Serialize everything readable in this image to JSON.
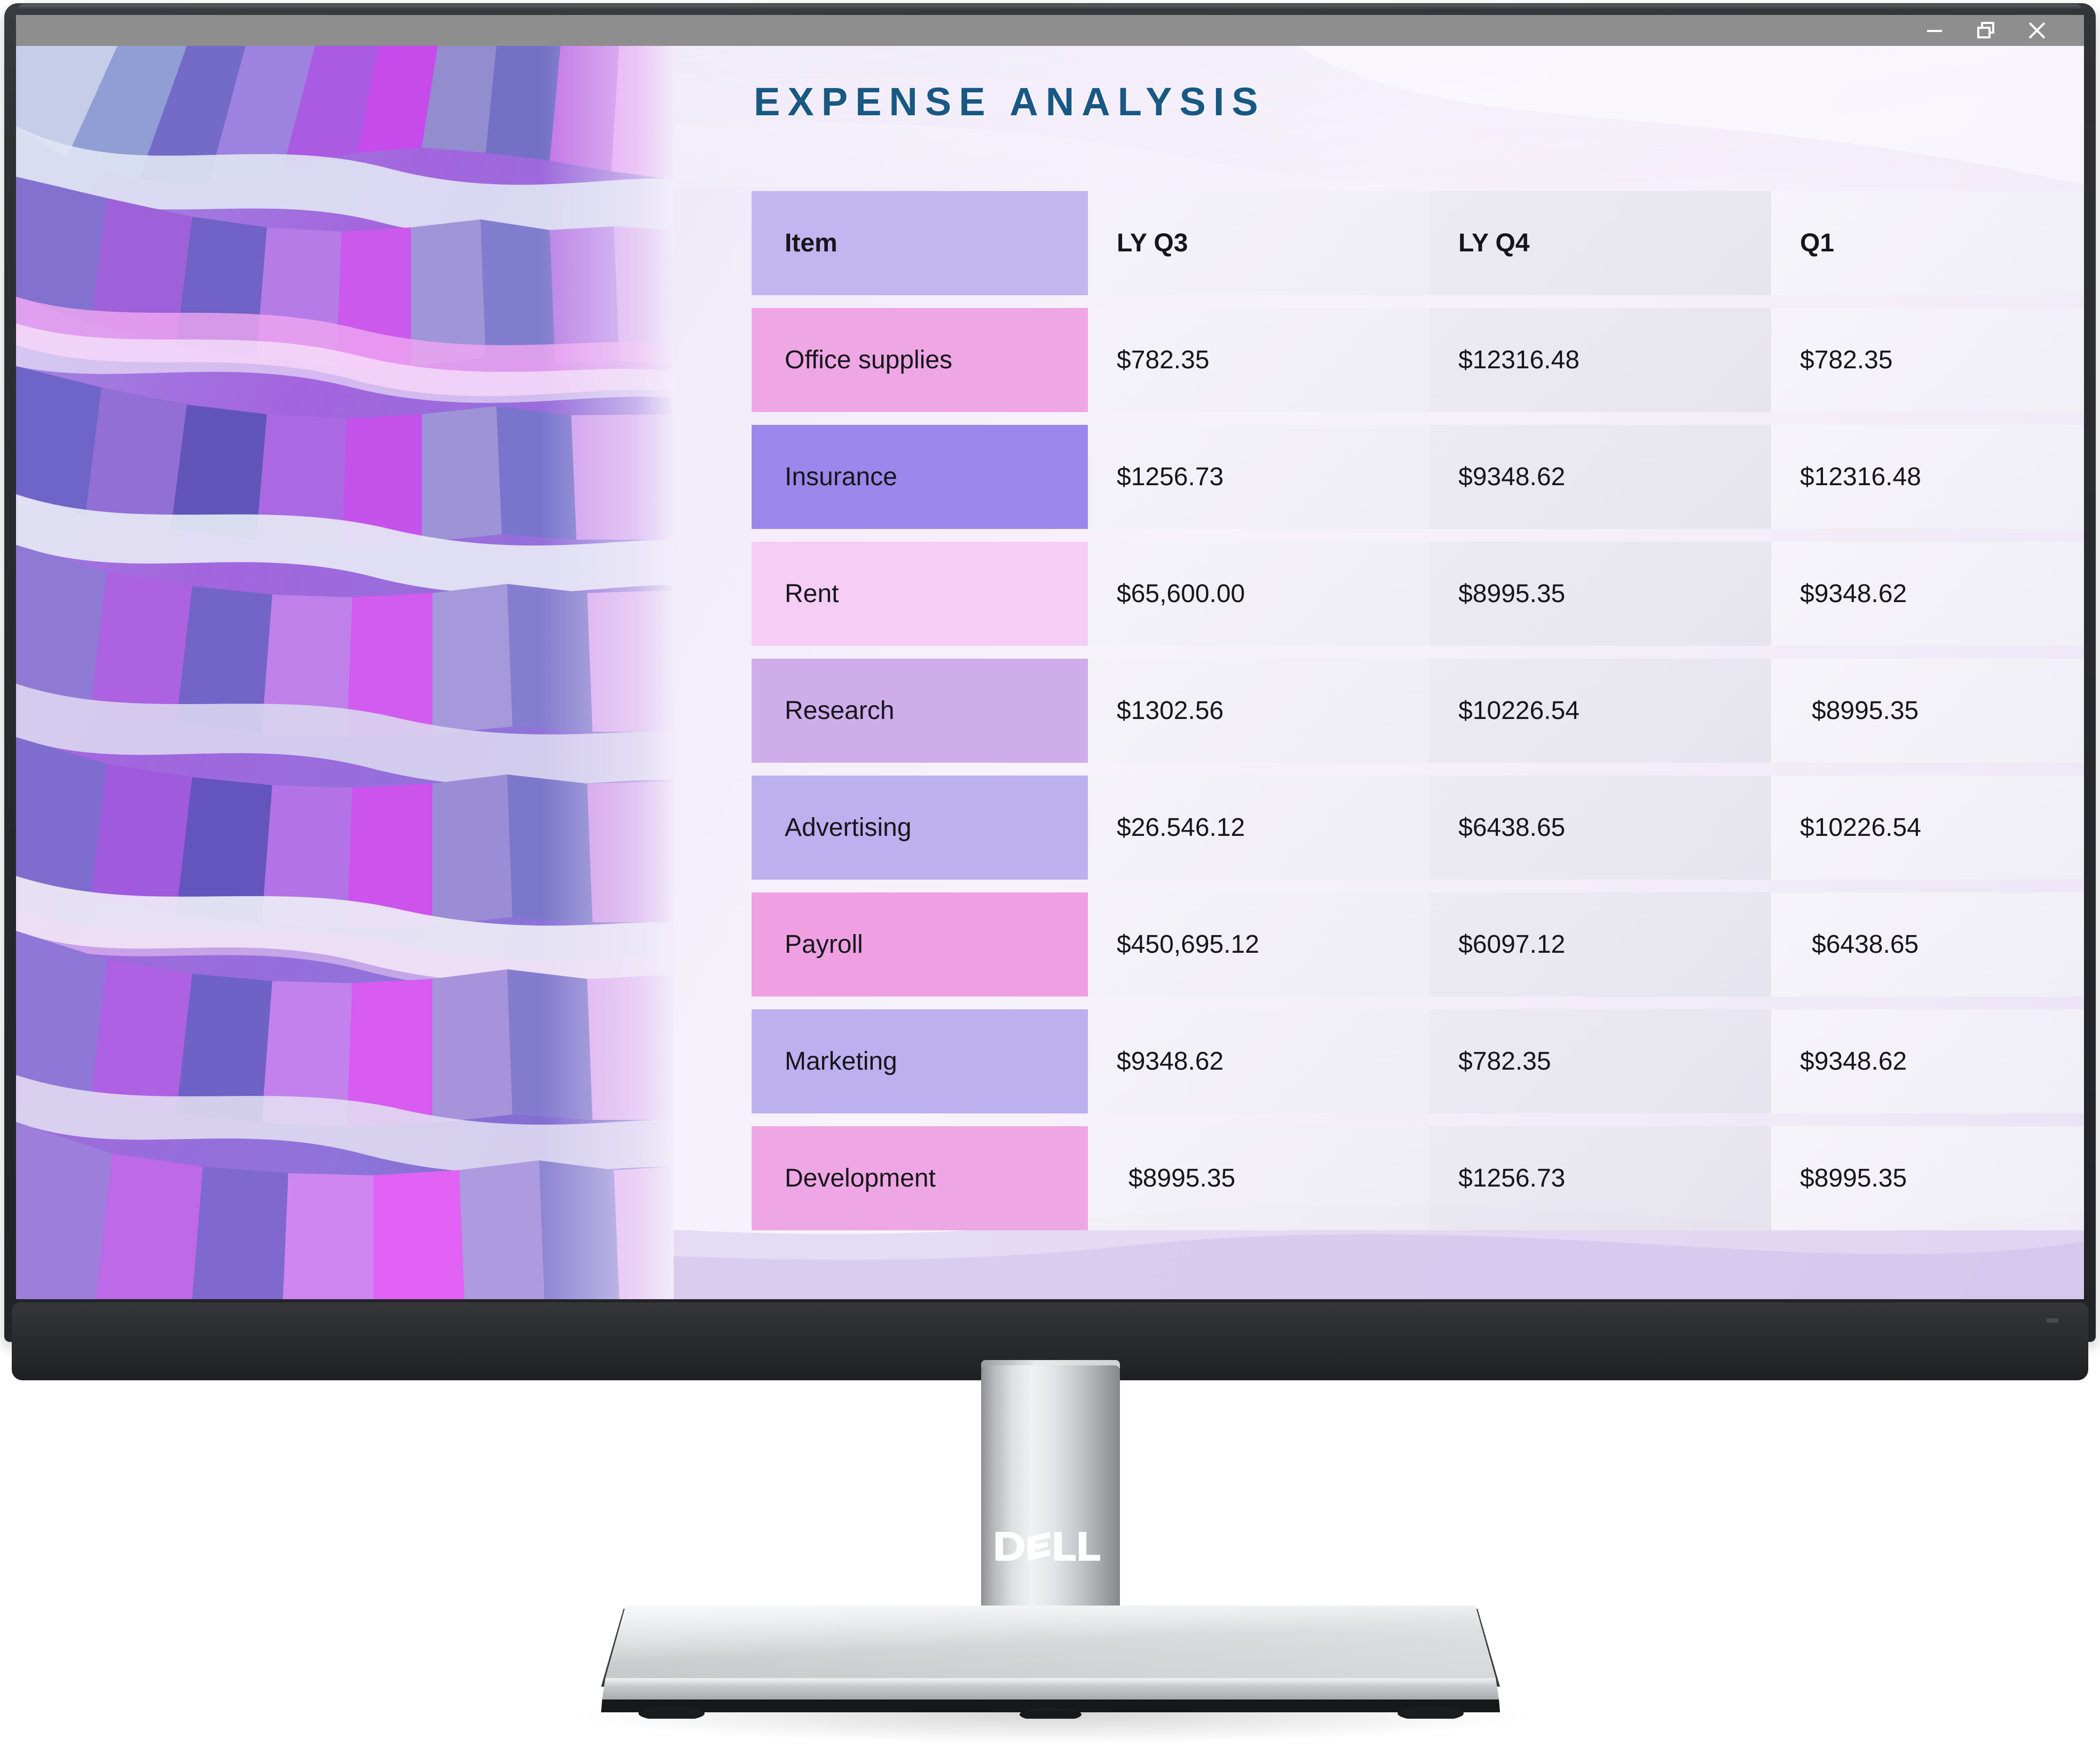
{
  "window": {
    "titlebar_color": "#8e8e8e",
    "controls": [
      {
        "name": "minimize",
        "glyph": "minimize-icon"
      },
      {
        "name": "restore",
        "glyph": "restore-icon"
      },
      {
        "name": "close",
        "glyph": "close-icon"
      }
    ]
  },
  "slide": {
    "title": "EXPENSE ANALYSIS",
    "title_color": "#185883",
    "background_colors": [
      "#e4dcf4",
      "#f7f2fb",
      "#e9e1f4"
    ]
  },
  "table": {
    "headers": [
      "Item",
      "LY Q3",
      "LY Q4",
      "Q1"
    ],
    "header_label_color": "#c3b5ef",
    "rows": [
      {
        "item": "Office supplies",
        "ly_q3": "$782.35",
        "ly_q4": "$12316.48",
        "q1": "$782.35",
        "label_color": "#efa6e4"
      },
      {
        "item": "Insurance",
        "ly_q3": "$1256.73",
        "ly_q4": "$9348.62",
        "q1": "$12316.48",
        "label_color": "#9b87eb"
      },
      {
        "item": "Rent",
        "ly_q3": "$65,600.00",
        "ly_q4": "$8995.35",
        "q1": "$9348.62",
        "label_color": "#f5cdf5"
      },
      {
        "item": "Research",
        "ly_q3": "$1302.56",
        "ly_q4": "$10226.54",
        "q1": "$8995.35",
        "label_color": "#cfacea"
      },
      {
        "item": "Advertising",
        "ly_q3": "$26.546.12",
        "ly_q4": "$6438.65",
        "q1": "$10226.54",
        "label_color": "#bcb0ef"
      },
      {
        "item": "Payroll",
        "ly_q3": "$450,695.12",
        "ly_q4": "$6097.12",
        "q1": "$6438.65",
        "label_color": "#efa0e3"
      },
      {
        "item": "Marketing",
        "ly_q3": "$9348.62",
        "ly_q4": "$782.35",
        "q1": "$9348.62",
        "label_color": "#bcb0ef"
      },
      {
        "item": "Development",
        "ly_q3": "$8995.35",
        "ly_q4": "$1256.73",
        "q1": "$8995.35",
        "label_color": "#efa6e4"
      }
    ]
  },
  "monitor": {
    "brand": "DELL",
    "bezel_color": "#2a2c30",
    "stand_color": "#d7d9dc"
  },
  "wallpaper": {
    "description": "abstract geometric faceted waves",
    "palette": [
      "#8f7fd6",
      "#c24ce8",
      "#b85ae8",
      "#6a5bc4",
      "#9aa6dd",
      "#e0c8f2",
      "#f0a8f0",
      "#5344b8",
      "#c9d2ea",
      "#efe2f7"
    ]
  }
}
